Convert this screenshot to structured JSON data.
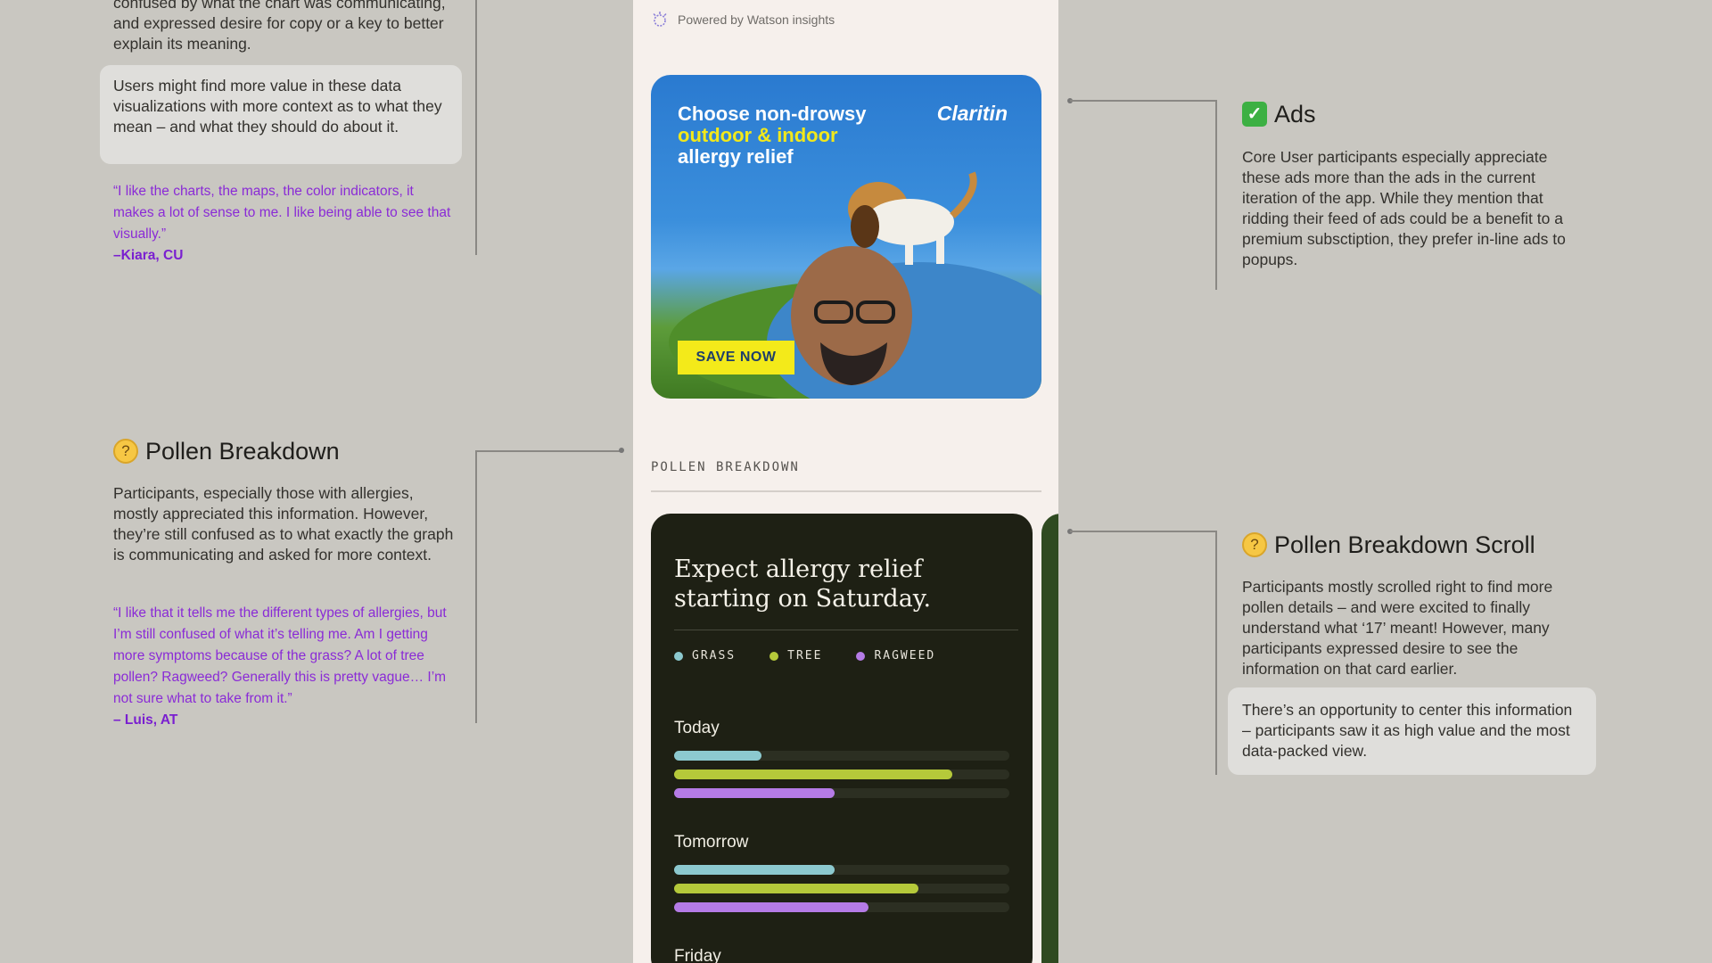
{
  "left": {
    "intro_fragment": "confused by what the chart was communicating, and expressed desire for copy or a key to better explain its meaning.",
    "callout": "Users might find more value in these data visualizations with more context as to what they mean – and what they should do about it.",
    "quote1": "“I like the charts, the maps, the color indicators, it makes a lot of sense to me. I like being able to see that visually.”",
    "quote1_author": "–Kiara, CU",
    "pollen_heading": "Pollen Breakdown",
    "pollen_body": "Participants, especially those with allergies, mostly appreciated this information. However, they’re still confused as to what exactly the graph is communicating and asked for more context.",
    "quote2": "“I like that it tells me the different types of allergies, but I’m still confused of what it’s telling me. Am I getting more symptoms because of the grass? A lot of tree pollen? Ragweed? Generally this is pretty vague… I’m not sure what to take from it.”",
    "quote2_author": "– Luis, AT"
  },
  "right": {
    "ads_heading": "Ads",
    "ads_body": "Core User participants especially appreciate these ads more than the ads in the current iteration of the app. While they mention that ridding their feed of ads could be a benefit to a premium subsctiption, they prefer in-line ads to popups.",
    "scroll_heading": "Pollen Breakdown Scroll",
    "scroll_body": "Participants mostly scrolled right to find more pollen details – and were excited to finally understand what ‘17’ meant!  However, many participants expressed desire to see the information on that card earlier.",
    "scroll_callout": "There’s an opportunity to center this information – participants saw it as high value and the most data-packed view."
  },
  "phone": {
    "powered_by": "Powered by Watson insights",
    "ad": {
      "line1": "Choose non-drowsy",
      "line2": "outdoor & indoor",
      "line3": "allergy relief",
      "brand": "Claritin",
      "cta": "SAVE NOW"
    },
    "section_label": "POLLEN BREAKDOWN",
    "card": {
      "title": "Expect allergy relief starting on Saturday.",
      "legend": [
        "GRASS",
        "TREE",
        "RAGWEED"
      ]
    }
  },
  "colors": {
    "grass": "#8cc9cf",
    "tree": "#b5c93a",
    "ragweed": "#b57be6",
    "quote": "#8a2bd6"
  },
  "chart_data": {
    "type": "bar",
    "title": "Expect allergy relief starting on Saturday.",
    "categories": [
      "Today",
      "Tomorrow",
      "Friday"
    ],
    "series": [
      {
        "name": "GRASS",
        "values": [
          0.26,
          0.48,
          null
        ]
      },
      {
        "name": "TREE",
        "values": [
          0.83,
          0.73,
          null
        ]
      },
      {
        "name": "RAGWEED",
        "values": [
          0.48,
          0.58,
          null
        ]
      }
    ],
    "ylim": [
      0,
      1
    ]
  }
}
